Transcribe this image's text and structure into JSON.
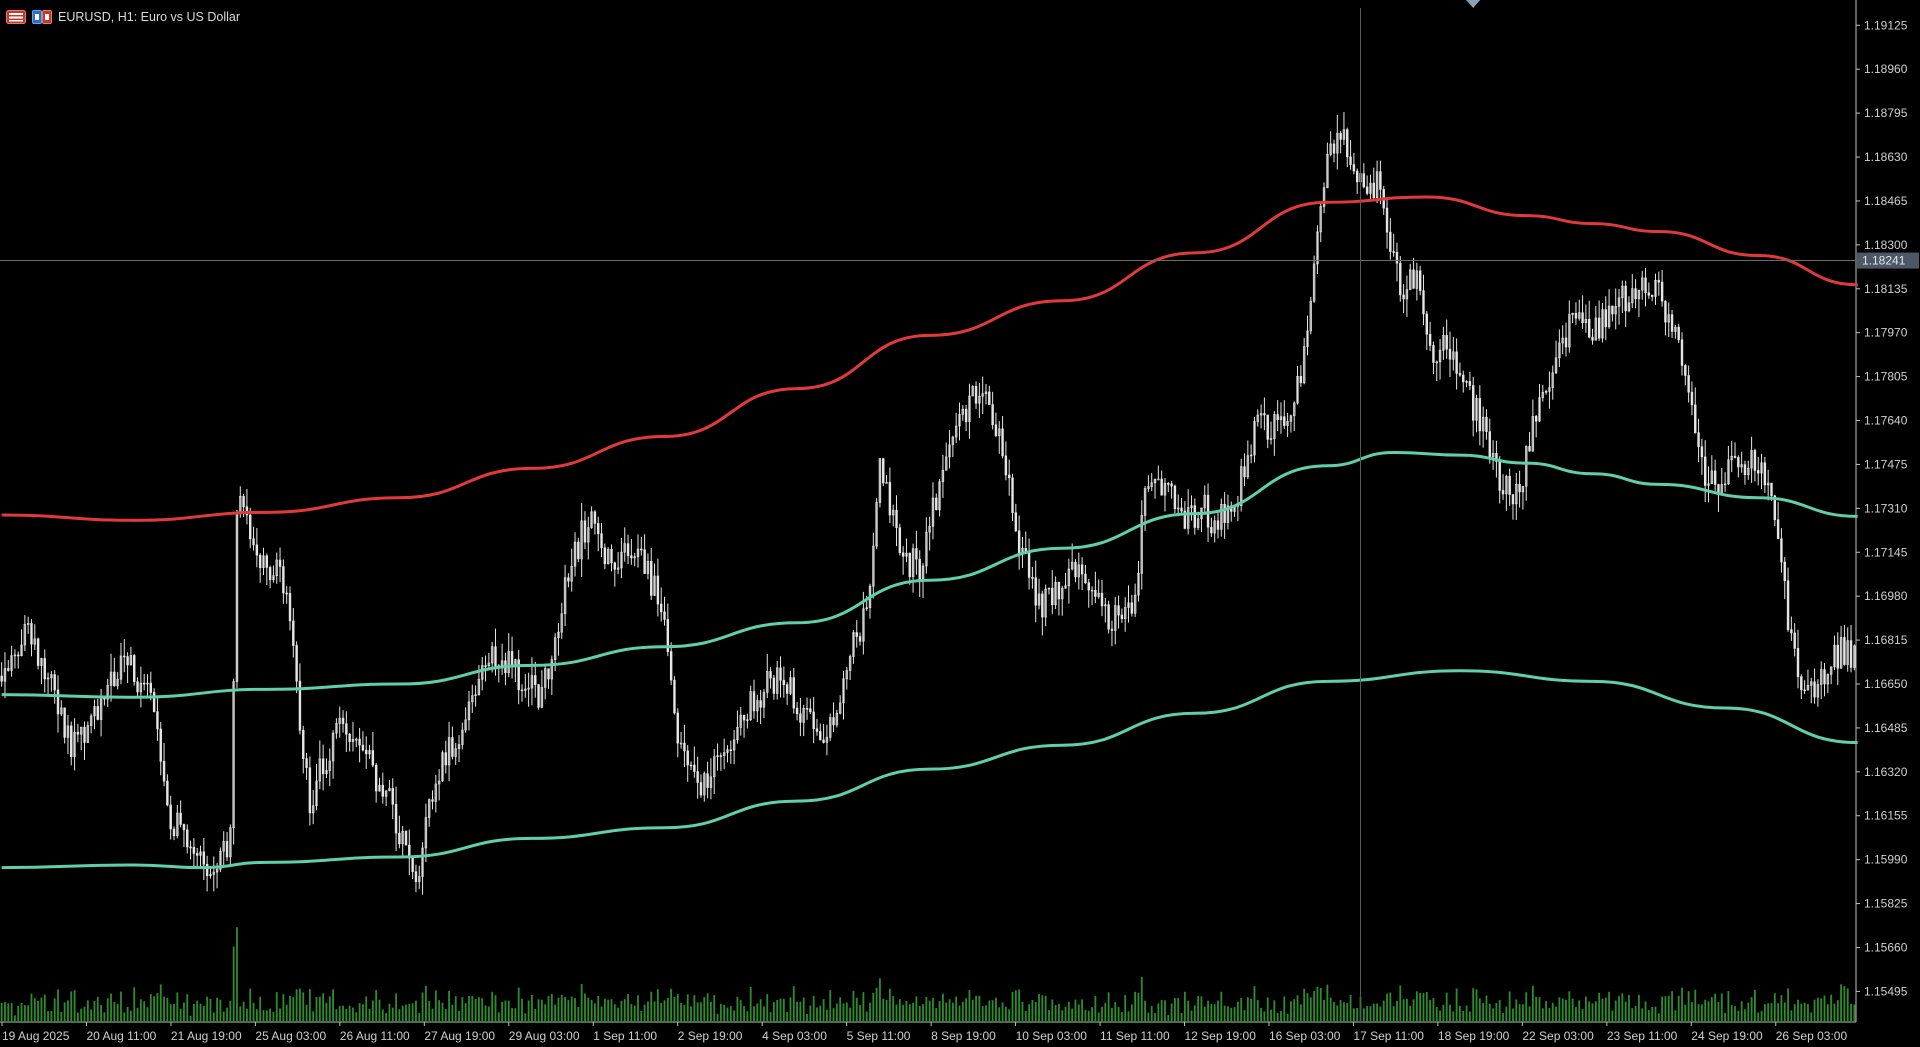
{
  "window": {
    "title": "EURUSD, H1:  Euro vs US Dollar",
    "icons": [
      "trading-menu-icon",
      "one-click-trading-icon"
    ]
  },
  "colors": {
    "background": "#000000",
    "candle": "#e6e6e6",
    "volume": "#2e8b2e",
    "axis_text": "#cfcfcf",
    "upper_band": "#e03a3a",
    "lower_band": "#5fd0a8",
    "price_line": "#6a6a6a",
    "price_label_bg": "#4d5866",
    "price_label_text": "#e0e6ee"
  },
  "chart_data": {
    "type": "candlestick",
    "symbol": "EURUSD",
    "timeframe": "H1",
    "current_price": 1.18241,
    "current_price_label": "1.18241",
    "ylim": [
      1.1538,
      1.1922
    ],
    "y_ticks": [
      "1.19125",
      "1.18960",
      "1.18795",
      "1.18630",
      "1.18465",
      "1.18300",
      "1.18135",
      "1.17970",
      "1.17805",
      "1.17640",
      "1.17475",
      "1.17310",
      "1.17145",
      "1.16980",
      "1.16815",
      "1.16650",
      "1.16485",
      "1.16320",
      "1.16155",
      "1.15990",
      "1.15825",
      "1.15660",
      "1.15495"
    ],
    "x_ticks": [
      "19 Aug 2025",
      "20 Aug 11:00",
      "21 Aug 19:00",
      "25 Aug 03:00",
      "26 Aug 11:00",
      "27 Aug 19:00",
      "29 Aug 03:00",
      "1 Sep 11:00",
      "2 Sep 19:00",
      "4 Sep 03:00",
      "5 Sep 11:00",
      "8 Sep 19:00",
      "10 Sep 03:00",
      "11 Sep 11:00",
      "12 Sep 19:00",
      "16 Sep 03:00",
      "17 Sep 11:00",
      "18 Sep 19:00",
      "22 Sep 03:00",
      "23 Sep 11:00",
      "24 Sep 19:00",
      "26 Sep 03:00"
    ],
    "bar_count": 560,
    "close_path": [
      [
        0,
        1.1668
      ],
      [
        8,
        1.1685
      ],
      [
        14,
        1.1672
      ],
      [
        22,
        1.1642
      ],
      [
        30,
        1.1655
      ],
      [
        38,
        1.1675
      ],
      [
        46,
        1.1658
      ],
      [
        52,
        1.1615
      ],
      [
        60,
        1.1605
      ],
      [
        64,
        1.1595
      ],
      [
        70,
        1.1605
      ],
      [
        72,
        1.1735
      ],
      [
        78,
        1.1715
      ],
      [
        86,
        1.1705
      ],
      [
        94,
        1.1622
      ],
      [
        102,
        1.1648
      ],
      [
        110,
        1.164
      ],
      [
        118,
        1.162
      ],
      [
        126,
        1.159
      ],
      [
        132,
        1.163
      ],
      [
        140,
        1.1648
      ],
      [
        148,
        1.1675
      ],
      [
        156,
        1.167
      ],
      [
        164,
        1.166
      ],
      [
        172,
        1.1705
      ],
      [
        178,
        1.1728
      ],
      [
        184,
        1.1712
      ],
      [
        192,
        1.1718
      ],
      [
        200,
        1.1695
      ],
      [
        205,
        1.1645
      ],
      [
        212,
        1.1628
      ],
      [
        220,
        1.164
      ],
      [
        228,
        1.166
      ],
      [
        236,
        1.1668
      ],
      [
        244,
        1.1652
      ],
      [
        250,
        1.1645
      ],
      [
        256,
        1.1672
      ],
      [
        262,
        1.1692
      ],
      [
        266,
        1.1752
      ],
      [
        272,
        1.1712
      ],
      [
        278,
        1.171
      ],
      [
        284,
        1.174
      ],
      [
        290,
        1.1765
      ],
      [
        296,
        1.1775
      ],
      [
        302,
        1.1762
      ],
      [
        308,
        1.1718
      ],
      [
        314,
        1.1695
      ],
      [
        320,
        1.17
      ],
      [
        326,
        1.1712
      ],
      [
        332,
        1.1695
      ],
      [
        338,
        1.1688
      ],
      [
        342,
        1.169
      ],
      [
        346,
        1.1735
      ],
      [
        352,
        1.1738
      ],
      [
        358,
        1.1725
      ],
      [
        364,
        1.173
      ],
      [
        368,
        1.1725
      ],
      [
        374,
        1.1738
      ],
      [
        380,
        1.1765
      ],
      [
        386,
        1.176
      ],
      [
        392,
        1.1775
      ],
      [
        396,
        1.181
      ],
      [
        400,
        1.1855
      ],
      [
        404,
        1.1875
      ],
      [
        408,
        1.1862
      ],
      [
        412,
        1.1848
      ],
      [
        416,
        1.1852
      ],
      [
        420,
        1.183
      ],
      [
        424,
        1.1812
      ],
      [
        428,
        1.182
      ],
      [
        432,
        1.179
      ],
      [
        436,
        1.1792
      ],
      [
        440,
        1.1785
      ],
      [
        444,
        1.1772
      ],
      [
        448,
        1.1762
      ],
      [
        452,
        1.1745
      ],
      [
        458,
        1.1735
      ],
      [
        462,
        1.1755
      ],
      [
        466,
        1.1775
      ],
      [
        472,
        1.1795
      ],
      [
        476,
        1.1803
      ],
      [
        482,
        1.1798
      ],
      [
        486,
        1.1805
      ],
      [
        490,
        1.181
      ],
      [
        496,
        1.1815
      ],
      [
        500,
        1.1812
      ],
      [
        504,
        1.1805
      ],
      [
        508,
        1.1785
      ],
      [
        512,
        1.1758
      ],
      [
        516,
        1.174
      ],
      [
        520,
        1.1742
      ],
      [
        524,
        1.1746
      ],
      [
        528,
        1.1748
      ],
      [
        532,
        1.1745
      ],
      [
        536,
        1.173
      ],
      [
        540,
        1.169
      ],
      [
        544,
        1.1662
      ],
      [
        548,
        1.166
      ],
      [
        552,
        1.1672
      ],
      [
        556,
        1.1678
      ],
      [
        560,
        1.1675
      ]
    ],
    "series": [
      {
        "name": "",
        "values": [
          [
            0,
            1.17285
          ],
          [
            40,
            1.17265
          ],
          [
            80,
            1.17295
          ],
          [
            120,
            1.1735
          ],
          [
            160,
            1.1746
          ],
          [
            200,
            1.1758
          ],
          [
            240,
            1.1776
          ],
          [
            280,
            1.1796
          ],
          [
            320,
            1.1809
          ],
          [
            360,
            1.1827
          ],
          [
            400,
            1.1846
          ],
          [
            430,
            1.1848
          ],
          [
            460,
            1.1841
          ],
          [
            480,
            1.1838
          ],
          [
            500,
            1.1835
          ],
          [
            530,
            1.1826
          ],
          [
            560,
            1.1815
          ]
        ]
      },
      {
        "name": "",
        "values": [
          [
            0,
            1.1661
          ],
          [
            40,
            1.166
          ],
          [
            80,
            1.1663
          ],
          [
            120,
            1.1665
          ],
          [
            160,
            1.1672
          ],
          [
            200,
            1.1679
          ],
          [
            240,
            1.1688
          ],
          [
            280,
            1.1704
          ],
          [
            320,
            1.1716
          ],
          [
            360,
            1.1729
          ],
          [
            400,
            1.1747
          ],
          [
            420,
            1.1752
          ],
          [
            440,
            1.1751
          ],
          [
            460,
            1.1748
          ],
          [
            480,
            1.1744
          ],
          [
            500,
            1.174
          ],
          [
            530,
            1.1735
          ],
          [
            560,
            1.1728
          ]
        ]
      },
      {
        "name": "",
        "values": [
          [
            0,
            1.1596
          ],
          [
            40,
            1.1597
          ],
          [
            60,
            1.1596
          ],
          [
            80,
            1.1598
          ],
          [
            120,
            1.16
          ],
          [
            160,
            1.1607
          ],
          [
            200,
            1.1611
          ],
          [
            240,
            1.1621
          ],
          [
            280,
            1.1633
          ],
          [
            320,
            1.1642
          ],
          [
            360,
            1.1654
          ],
          [
            400,
            1.1666
          ],
          [
            440,
            1.167
          ],
          [
            480,
            1.1666
          ],
          [
            520,
            1.1656
          ],
          [
            560,
            1.1643
          ]
        ]
      }
    ]
  }
}
